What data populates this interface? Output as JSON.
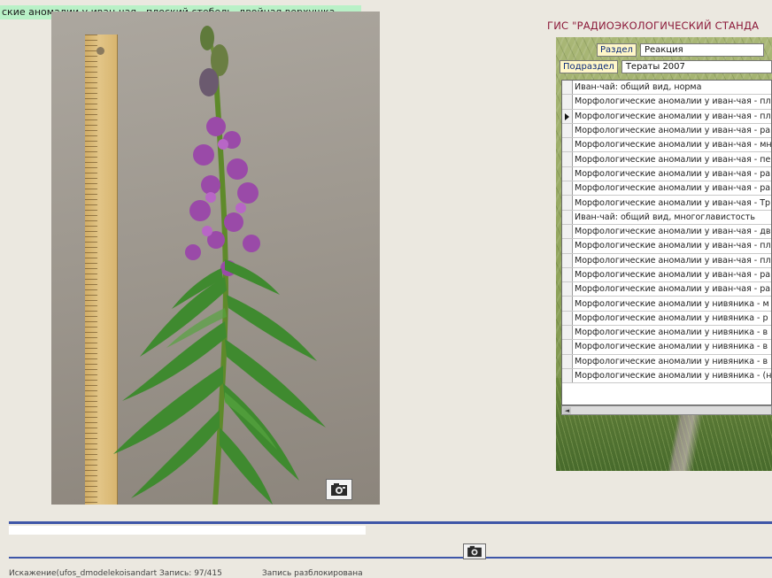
{
  "caption": "ские аномалии у иван-чая - плоский стебель, двойная верхушка",
  "gis": {
    "title": "ГИС \"РАДИОЭКОЛОГИЧЕСКИЙ СТАНДА",
    "section_label": "Раздел",
    "section_value": "Реакция",
    "subsection_label": "Подраздел",
    "subsection_value": "Тераты 2007",
    "selected_index": 2,
    "list_items": [
      "Иван-чай: общий вид, норма",
      "Морфологические аномалии у иван-чая - пл",
      "Морфологические аномалии у иван-чая - пл",
      "Морфологические аномалии у иван-чая - ра",
      "Морфологические аномалии у иван-чая - мн",
      "Морфологические аномалии у иван-чая - пе",
      "Морфологические аномалии у иван-чая - ра",
      "Морфологические аномалии у иван-чая - ра",
      "Морфологические аномалии у иван-чая - Тр",
      "Иван-чай: общий вид, многоглавистость",
      "Морфологические аномалии у иван-чая - дв",
      "Морфологические аномалии у иван-чая - пл",
      "Морфологические аномалии у иван-чая - пл",
      "Морфологические аномалии у иван-чая - ра",
      "Морфологические аномалии у иван-чая - ра",
      "Морфологические аномалии у нивяника - м",
      "Морфологические аномалии у нивяника - р",
      "Морфологические аномалии у нивяника - в",
      "Морфологические аномалии у нивяника - в",
      "Морфологические аномалии у нивяника - в",
      "Морфологические аномалии у нивяника - (н"
    ]
  },
  "icons": {
    "photo_button": "camera-icon",
    "center_button": "camera-icon"
  },
  "status": {
    "left": "Искажение(ufos_dmodelekoisandart Запись: 97/415",
    "right": "Запись разблокирована"
  },
  "colors": {
    "caption_bg": "#b9f1c7",
    "title": "#8c1a3a",
    "divider": "#3e56a8",
    "panel_green": "#8fa35a"
  }
}
